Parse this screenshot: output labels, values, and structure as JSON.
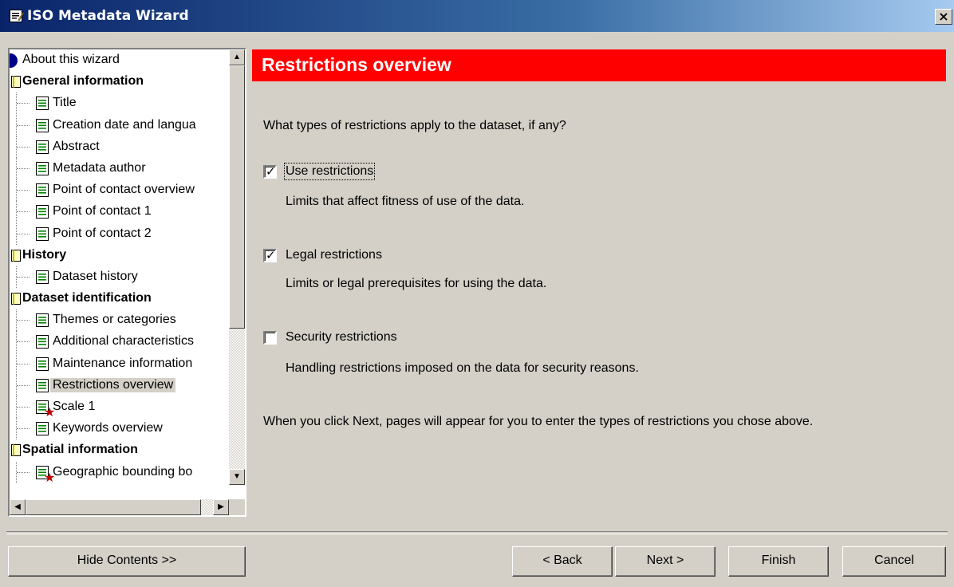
{
  "window": {
    "title": "ISO Metadata Wizard",
    "close_glyph": "×"
  },
  "tree": {
    "items": [
      {
        "label": "About this wizard",
        "kind": "about"
      },
      {
        "label": "General information",
        "kind": "header"
      },
      {
        "label": "Title",
        "kind": "page"
      },
      {
        "label": "Creation date and langua",
        "kind": "page"
      },
      {
        "label": "Abstract",
        "kind": "page"
      },
      {
        "label": "Metadata author",
        "kind": "page"
      },
      {
        "label": "Point of contact overview",
        "kind": "page"
      },
      {
        "label": "Point of contact 1",
        "kind": "page"
      },
      {
        "label": "Point of contact 2",
        "kind": "page"
      },
      {
        "label": "History",
        "kind": "header"
      },
      {
        "label": "Dataset history",
        "kind": "page"
      },
      {
        "label": "Dataset identification",
        "kind": "header"
      },
      {
        "label": "Themes or categories",
        "kind": "page"
      },
      {
        "label": "Additional characteristics",
        "kind": "page"
      },
      {
        "label": "Maintenance information",
        "kind": "page"
      },
      {
        "label": "Restrictions overview",
        "kind": "page",
        "selected": true
      },
      {
        "label": "Scale 1",
        "kind": "page",
        "required": true
      },
      {
        "label": "Keywords overview",
        "kind": "page"
      },
      {
        "label": "Spatial information",
        "kind": "header"
      },
      {
        "label": "Geographic bounding bo",
        "kind": "page",
        "required": true
      }
    ],
    "scroll_up_glyph": "▲",
    "scroll_down_glyph": "▼",
    "scroll_left_glyph": "◀",
    "scroll_right_glyph": "▶"
  },
  "page": {
    "title": "Restrictions overview",
    "question": "What types of restrictions apply to the dataset, if any?",
    "options": [
      {
        "label": "Use restrictions",
        "checked": true,
        "description": "Limits that affect fitness of use of the data."
      },
      {
        "label": "Legal restrictions",
        "checked": true,
        "description": "Limits or legal prerequisites for using the data."
      },
      {
        "label": "Security restrictions",
        "checked": false,
        "description": "Handling restrictions imposed on the data for security reasons."
      }
    ],
    "check_glyph": "✓",
    "footer_note": "When you click Next, pages will appear for you to enter the types of restrictions you chose above."
  },
  "buttons": {
    "hide_contents": "Hide Contents >>",
    "back": "< Back",
    "next": "Next >",
    "finish": "Finish",
    "cancel": "Cancel"
  },
  "colors": {
    "banner": "#ff0000",
    "titlebar": "#0a246a",
    "face": "#d4d0c8"
  }
}
